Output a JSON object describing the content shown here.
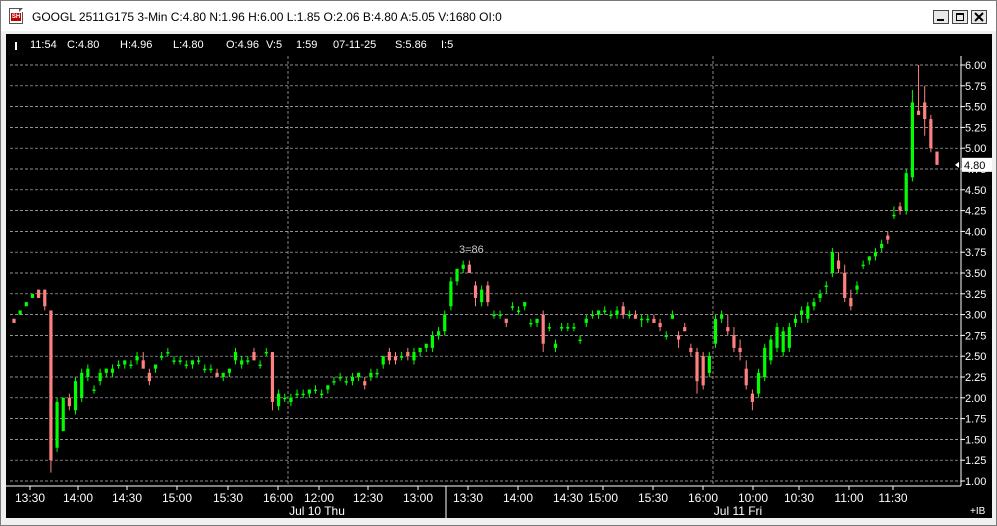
{
  "window": {
    "title": "GOOGL 2511G175 3-Min C:4.80 N:1.96 H:6.00 L:1.85 O:2.06 B:4.80 A:5.05 V:1680 OI:0",
    "buttons": [
      "minimize",
      "maximize",
      "close"
    ]
  },
  "info_bar": {
    "time": "11:54",
    "close": "C:4.80",
    "high": "H:4.96",
    "low": "L:4.80",
    "open": "O:4.96",
    "volume": "V:5",
    "duration": "1:59",
    "date": "07-11-25",
    "sale": "S:5.86",
    "last": "I:5"
  },
  "colors": {
    "background": "#000000",
    "up": "#00ff00",
    "down": "#ff8080",
    "grid": "#bfbfbf",
    "text": "#ffffff"
  },
  "chart_data": {
    "type": "candlestick",
    "y_ticks": [
      "6.00",
      "5.75",
      "5.50",
      "5.25",
      "5.00",
      "4.75",
      "4.50",
      "4.25",
      "4.00",
      "3.75",
      "3.50",
      "3.25",
      "3.00",
      "2.75",
      "2.50",
      "2.25",
      "2.00",
      "1.75",
      "1.50",
      "1.25",
      "1.00"
    ],
    "ylim": [
      1.0,
      6.0
    ],
    "current_price_label": "4.80",
    "current_price": 4.8,
    "peak_annotation": "3=86",
    "x_ticks": [
      "13:30",
      "14:00",
      "14:30",
      "15:00",
      "15:30",
      "16:00",
      "12:00",
      "12:30",
      "13:00",
      "13:30",
      "14:00",
      "14:30",
      "15:00",
      "15:30",
      "16:00",
      "10:00",
      "10:30",
      "11:00",
      "11:30"
    ],
    "day_labels": [
      "Jul 10 Thu",
      "Jul 11 Fri"
    ],
    "corner_label": "+IB",
    "candles": [
      [
        2.95,
        2.95,
        2.9,
        2.9
      ],
      [
        3.0,
        3.05,
        3.0,
        3.05
      ],
      [
        3.1,
        3.15,
        3.1,
        3.15
      ],
      [
        3.2,
        3.25,
        3.2,
        3.25
      ],
      [
        3.3,
        3.3,
        3.2,
        3.2
      ],
      [
        3.3,
        3.3,
        3.05,
        3.1
      ],
      [
        3.05,
        3.05,
        1.1,
        1.25
      ],
      [
        1.4,
        2.0,
        1.35,
        1.95
      ],
      [
        1.6,
        2.0,
        1.6,
        2.0
      ],
      [
        2.0,
        2.05,
        1.85,
        1.9
      ],
      [
        1.85,
        2.25,
        1.8,
        2.2
      ],
      [
        2.0,
        2.35,
        1.95,
        2.3
      ],
      [
        2.25,
        2.4,
        2.2,
        2.35
      ],
      [
        2.1,
        2.15,
        2.05,
        2.1
      ],
      [
        2.2,
        2.35,
        2.15,
        2.3
      ],
      [
        2.3,
        2.35,
        2.25,
        2.35
      ],
      [
        2.3,
        2.4,
        2.25,
        2.35
      ],
      [
        2.4,
        2.45,
        2.35,
        2.4
      ],
      [
        2.4,
        2.45,
        2.35,
        2.45
      ],
      [
        2.4,
        2.45,
        2.35,
        2.4
      ],
      [
        2.45,
        2.55,
        2.4,
        2.5
      ],
      [
        2.45,
        2.55,
        2.4,
        2.35
      ],
      [
        2.3,
        2.35,
        2.15,
        2.2
      ],
      [
        2.35,
        2.4,
        2.3,
        2.4
      ],
      [
        2.5,
        2.55,
        2.45,
        2.5
      ],
      [
        2.55,
        2.6,
        2.5,
        2.55
      ],
      [
        2.45,
        2.5,
        2.4,
        2.45
      ],
      [
        2.45,
        2.5,
        2.4,
        2.45
      ],
      [
        2.4,
        2.45,
        2.35,
        2.4
      ],
      [
        2.4,
        2.45,
        2.35,
        2.45
      ],
      [
        2.45,
        2.5,
        2.4,
        2.45
      ],
      [
        2.35,
        2.4,
        2.3,
        2.35
      ],
      [
        2.35,
        2.4,
        2.3,
        2.35
      ],
      [
        2.3,
        2.35,
        2.25,
        2.25
      ],
      [
        2.25,
        2.3,
        2.2,
        2.3
      ],
      [
        2.3,
        2.35,
        2.25,
        2.35
      ],
      [
        2.45,
        2.6,
        2.4,
        2.55
      ],
      [
        2.4,
        2.5,
        2.35,
        2.45
      ],
      [
        2.45,
        2.5,
        2.4,
        2.45
      ],
      [
        2.55,
        2.6,
        2.45,
        2.45
      ],
      [
        2.4,
        2.45,
        2.35,
        2.4
      ],
      [
        2.55,
        2.6,
        2.5,
        2.55
      ],
      [
        2.55,
        2.55,
        1.85,
        1.95
      ],
      [
        1.9,
        2.1,
        1.85,
        2.05
      ],
      [
        2.0,
        2.05,
        1.95,
        2.0
      ],
      [
        1.95,
        2.05,
        1.9,
        2.0
      ],
      [
        2.05,
        2.1,
        2.0,
        2.05
      ],
      [
        2.05,
        2.1,
        2.0,
        2.05
      ],
      [
        2.05,
        2.1,
        2.0,
        2.1
      ],
      [
        2.1,
        2.15,
        2.05,
        2.1
      ],
      [
        2.05,
        2.1,
        2.0,
        2.05
      ],
      [
        2.1,
        2.15,
        2.05,
        2.15
      ],
      [
        2.2,
        2.25,
        2.15,
        2.2
      ],
      [
        2.25,
        2.3,
        2.2,
        2.25
      ],
      [
        2.2,
        2.25,
        2.15,
        2.2
      ],
      [
        2.2,
        2.3,
        2.15,
        2.25
      ],
      [
        2.25,
        2.3,
        2.2,
        2.3
      ],
      [
        2.2,
        2.25,
        2.1,
        2.15
      ],
      [
        2.25,
        2.35,
        2.2,
        2.3
      ],
      [
        2.3,
        2.35,
        2.25,
        2.3
      ],
      [
        2.4,
        2.5,
        2.35,
        2.5
      ],
      [
        2.55,
        2.6,
        2.4,
        2.45
      ],
      [
        2.5,
        2.55,
        2.4,
        2.45
      ],
      [
        2.5,
        2.55,
        2.45,
        2.5
      ],
      [
        2.55,
        2.6,
        2.45,
        2.5
      ],
      [
        2.45,
        2.6,
        2.4,
        2.55
      ],
      [
        2.55,
        2.6,
        2.5,
        2.6
      ],
      [
        2.6,
        2.65,
        2.55,
        2.65
      ],
      [
        2.6,
        2.8,
        2.55,
        2.75
      ],
      [
        2.75,
        2.85,
        2.7,
        2.8
      ],
      [
        2.8,
        3.05,
        2.75,
        3.0
      ],
      [
        3.1,
        3.45,
        3.05,
        3.4
      ],
      [
        3.4,
        3.55,
        3.35,
        3.55
      ],
      [
        3.55,
        3.65,
        3.5,
        3.6
      ],
      [
        3.6,
        3.65,
        3.5,
        3.5
      ],
      [
        3.35,
        3.4,
        3.1,
        3.2
      ],
      [
        3.15,
        3.35,
        3.1,
        3.3
      ],
      [
        3.35,
        3.4,
        3.1,
        3.15
      ],
      [
        3.0,
        3.05,
        2.95,
        3.0
      ],
      [
        3.0,
        3.05,
        2.95,
        3.0
      ],
      [
        2.95,
        2.95,
        2.85,
        2.9
      ],
      [
        3.1,
        3.15,
        3.05,
        3.1
      ],
      [
        3.05,
        3.1,
        3.0,
        3.05
      ],
      [
        3.1,
        3.15,
        3.05,
        3.15
      ],
      [
        2.9,
        2.95,
        2.85,
        2.9
      ],
      [
        2.9,
        2.95,
        2.85,
        2.95
      ],
      [
        3.0,
        3.05,
        2.55,
        2.65
      ],
      [
        2.85,
        2.9,
        2.8,
        2.85
      ],
      [
        2.6,
        2.7,
        2.55,
        2.65
      ],
      [
        2.85,
        2.9,
        2.8,
        2.85
      ],
      [
        2.85,
        2.9,
        2.8,
        2.85
      ],
      [
        2.85,
        2.9,
        2.8,
        2.85
      ],
      [
        2.7,
        2.75,
        2.65,
        2.7
      ],
      [
        2.9,
        3.0,
        2.85,
        2.95
      ],
      [
        3.0,
        3.05,
        2.95,
        3.0
      ],
      [
        3.0,
        3.05,
        2.95,
        3.05
      ],
      [
        3.05,
        3.1,
        3.0,
        3.05
      ],
      [
        3.0,
        3.05,
        2.95,
        3.0
      ],
      [
        3.0,
        3.1,
        2.95,
        3.05
      ],
      [
        3.1,
        3.15,
        2.95,
        3.0
      ],
      [
        3.0,
        3.05,
        2.95,
        3.0
      ],
      [
        3.0,
        3.05,
        2.95,
        2.95
      ],
      [
        2.95,
        3.0,
        2.85,
        2.95
      ],
      [
        2.95,
        3.0,
        2.9,
        2.95
      ],
      [
        2.95,
        3.0,
        2.9,
        2.9
      ],
      [
        2.9,
        2.95,
        2.8,
        2.85
      ],
      [
        2.75,
        2.8,
        2.7,
        2.75
      ],
      [
        2.95,
        3.05,
        2.95,
        3.0
      ],
      [
        2.75,
        2.8,
        2.6,
        2.7
      ],
      [
        2.85,
        2.9,
        2.8,
        2.8
      ],
      [
        2.6,
        2.65,
        2.5,
        2.55
      ],
      [
        2.55,
        2.6,
        2.05,
        2.2
      ],
      [
        2.5,
        2.55,
        2.1,
        2.15
      ],
      [
        2.3,
        2.55,
        2.25,
        2.5
      ],
      [
        2.65,
        3.0,
        2.6,
        2.95
      ],
      [
        2.95,
        3.05,
        2.9,
        3.0
      ],
      [
        2.85,
        3.0,
        2.75,
        2.8
      ],
      [
        2.75,
        2.85,
        2.55,
        2.6
      ],
      [
        2.6,
        2.7,
        2.45,
        2.55
      ],
      [
        2.35,
        2.45,
        2.1,
        2.15
      ],
      [
        2.05,
        2.1,
        1.85,
        1.95
      ],
      [
        2.05,
        2.35,
        2.0,
        2.3
      ],
      [
        2.25,
        2.65,
        2.2,
        2.6
      ],
      [
        2.45,
        2.75,
        2.4,
        2.7
      ],
      [
        2.6,
        2.9,
        2.55,
        2.85
      ],
      [
        2.55,
        2.85,
        2.5,
        2.8
      ],
      [
        2.6,
        2.9,
        2.55,
        2.85
      ],
      [
        2.9,
        3.0,
        2.85,
        2.95
      ],
      [
        3.0,
        3.1,
        2.9,
        3.05
      ],
      [
        2.95,
        3.15,
        2.9,
        3.1
      ],
      [
        3.1,
        3.2,
        3.05,
        3.15
      ],
      [
        3.2,
        3.3,
        3.15,
        3.25
      ],
      [
        3.35,
        3.4,
        3.25,
        3.35
      ],
      [
        3.5,
        3.8,
        3.45,
        3.75
      ],
      [
        3.65,
        3.75,
        3.5,
        3.55
      ],
      [
        3.5,
        3.6,
        3.15,
        3.2
      ],
      [
        3.2,
        3.3,
        3.05,
        3.1
      ],
      [
        3.3,
        3.4,
        3.25,
        3.35
      ],
      [
        3.6,
        3.65,
        3.55,
        3.6
      ],
      [
        3.65,
        3.7,
        3.6,
        3.7
      ],
      [
        3.7,
        3.8,
        3.65,
        3.75
      ],
      [
        3.8,
        3.9,
        3.75,
        3.85
      ],
      [
        3.95,
        4.0,
        3.85,
        3.9
      ],
      [
        4.2,
        4.3,
        4.15,
        4.2
      ],
      [
        4.3,
        4.35,
        4.2,
        4.25
      ],
      [
        4.25,
        4.75,
        4.2,
        4.7
      ],
      [
        4.65,
        5.7,
        4.6,
        5.55
      ],
      [
        5.45,
        6.0,
        5.4,
        5.4
      ],
      [
        5.55,
        5.75,
        5.15,
        5.35
      ],
      [
        5.35,
        5.4,
        4.95,
        5.0
      ],
      [
        4.96,
        4.96,
        4.8,
        4.8
      ]
    ]
  }
}
